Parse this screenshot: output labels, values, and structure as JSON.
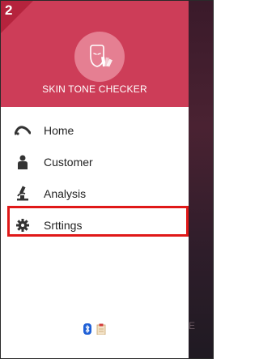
{
  "badge": {
    "number": "2"
  },
  "header": {
    "app_title": "SKIN TONE CHECKER"
  },
  "menu": {
    "items": [
      {
        "label": "Home",
        "icon": "home-swoosh-icon"
      },
      {
        "label": "Customer",
        "icon": "person-icon"
      },
      {
        "label": "Analysis",
        "icon": "microscope-icon"
      },
      {
        "label": "Srttings",
        "icon": "gear-icon"
      }
    ]
  },
  "footer": {
    "icons": [
      "bluetooth-icon",
      "clipboard-icon"
    ]
  },
  "backdrop": {
    "partial_text": "E"
  },
  "colors": {
    "header": "#cd3d58",
    "badge": "#b5233d",
    "highlight": "#e01818"
  }
}
